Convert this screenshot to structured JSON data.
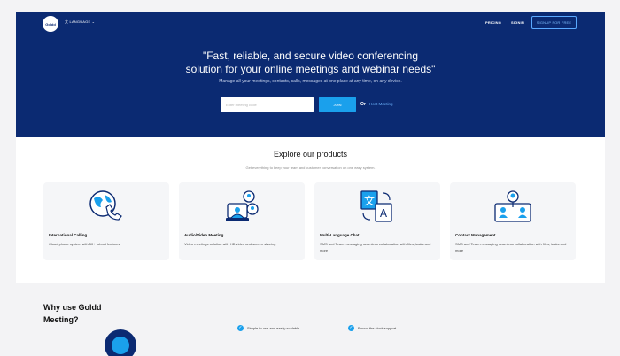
{
  "header": {
    "logo_text": "Goldd",
    "language": "LANGUAGE",
    "nav": [
      "PRICING",
      "SIGNIN"
    ],
    "signup": "SIGNUP FOR FREE"
  },
  "hero": {
    "headline_1": "\"Fast, reliable, and secure video conferencing",
    "headline_2": "solution for your online meetings and webinar needs\"",
    "subtext": "Manage all your meetings, contacts, calls, messages at one place at any time, on any device.",
    "meeting_code_placeholder": "Enter meeting code",
    "join_label": "JOIN",
    "or_label": "Or",
    "host_label": "Host Meeting"
  },
  "products": {
    "title": "Explore our products",
    "subtitle": "Get everything to keep your team and customer conversation on one easy system.",
    "cards": [
      {
        "title": "International Calling",
        "desc": "Cloud phone system with 50+ robust features",
        "icon": "globe-phone-icon"
      },
      {
        "title": "Audio/Video Meeting",
        "desc": "Video meetings solution with HD video and screen sharing",
        "icon": "video-meeting-icon"
      },
      {
        "title": "Multi-Language Chat",
        "desc": "SMS and Team messaging seamless collaboration with files, tasks and more",
        "icon": "translate-icon"
      },
      {
        "title": "Contact Management",
        "desc": "SMS and Team messaging seamless collaboration with files, tasks and more",
        "icon": "contacts-icon"
      }
    ]
  },
  "why": {
    "title_1": "Why use Goldd",
    "title_2": "Meeting?",
    "features": [
      "Simple to use and easily scalable",
      "Round the clock support"
    ]
  },
  "colors": {
    "brand_navy": "#0b2a72",
    "accent_blue": "#1aa0ec"
  }
}
